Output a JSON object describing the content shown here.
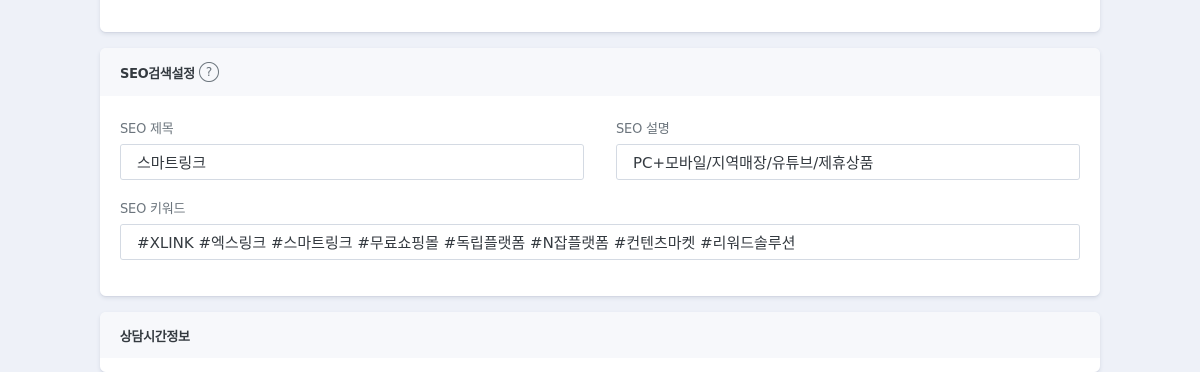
{
  "seo_section": {
    "title": "SEO검색설정",
    "help_icon": "?",
    "fields": {
      "title": {
        "label": "SEO 제목",
        "value": "스마트링크"
      },
      "description": {
        "label": "SEO 설명",
        "value": "PC+모바일/지역매장/유튜브/제휴상품"
      },
      "keywords": {
        "label": "SEO 키워드",
        "value": "#XLINK #엑스링크 #스마트링크 #무료쇼핑몰 #독립플랫폼 #N잡플랫폼 #컨텐츠마켓 #리워드솔루션"
      }
    }
  },
  "hours_section": {
    "title": "상담시간정보"
  }
}
